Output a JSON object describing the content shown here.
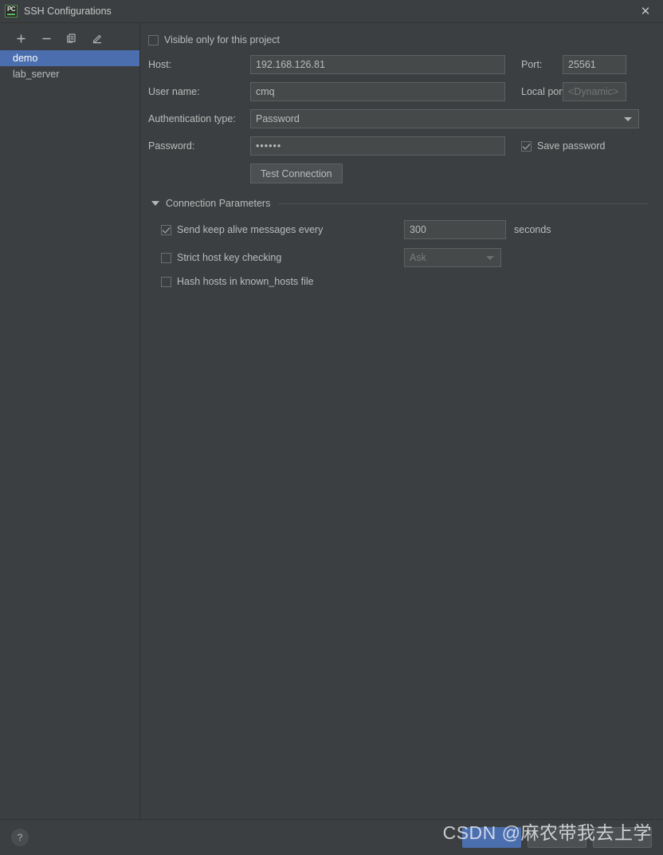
{
  "window": {
    "title": "SSH Configurations",
    "logo_icon": "pycharm-logo-icon",
    "close_icon": "close-icon"
  },
  "sidebar": {
    "toolbar": [
      {
        "icon": "add-icon",
        "glyph": "+",
        "name": "add-configuration-button"
      },
      {
        "icon": "remove-icon",
        "glyph": "−",
        "name": "remove-configuration-button"
      },
      {
        "icon": "copy-icon",
        "glyph": "❐",
        "name": "duplicate-configuration-button"
      },
      {
        "icon": "edit-pencil-icon",
        "glyph": "✎",
        "name": "edit-configuration-button"
      }
    ],
    "items": [
      {
        "label": "demo",
        "selected": true
      },
      {
        "label": "lab_server",
        "selected": false
      }
    ]
  },
  "form": {
    "visible_only_label": "Visible only for this project",
    "visible_only_checked": false,
    "host_label": "Host:",
    "host_value": "192.168.126.81",
    "port_label": "Port:",
    "port_value": "25561",
    "username_label": "User name:",
    "username_value": "cmq",
    "local_port_label": "Local port:",
    "local_port_placeholder": "<Dynamic>",
    "auth_type_label": "Authentication type:",
    "auth_type_value": "Password",
    "password_label": "Password:",
    "password_value": "••••••",
    "save_password_label": "Save password",
    "save_password_checked": true,
    "test_connection_label": "Test Connection"
  },
  "connection_parameters": {
    "section_title": "Connection Parameters",
    "expanded": true,
    "keep_alive_label": "Send keep alive messages every",
    "keep_alive_checked": true,
    "keep_alive_value": "300",
    "keep_alive_unit": "seconds",
    "strict_host_label": "Strict host key checking",
    "strict_host_checked": false,
    "strict_host_value": "Ask",
    "hash_hosts_label": "Hash hosts in known_hosts file",
    "hash_hosts_checked": false
  },
  "footer": {
    "help_label": "?",
    "ok_label": "",
    "cancel_label": "",
    "apply_label": "",
    "watermark": "CSDN @麻农带我去上学"
  },
  "colors": {
    "background": "#3c3f41",
    "field": "#45494a",
    "accent": "#4b6eaf",
    "text": "#bbbbbb"
  }
}
